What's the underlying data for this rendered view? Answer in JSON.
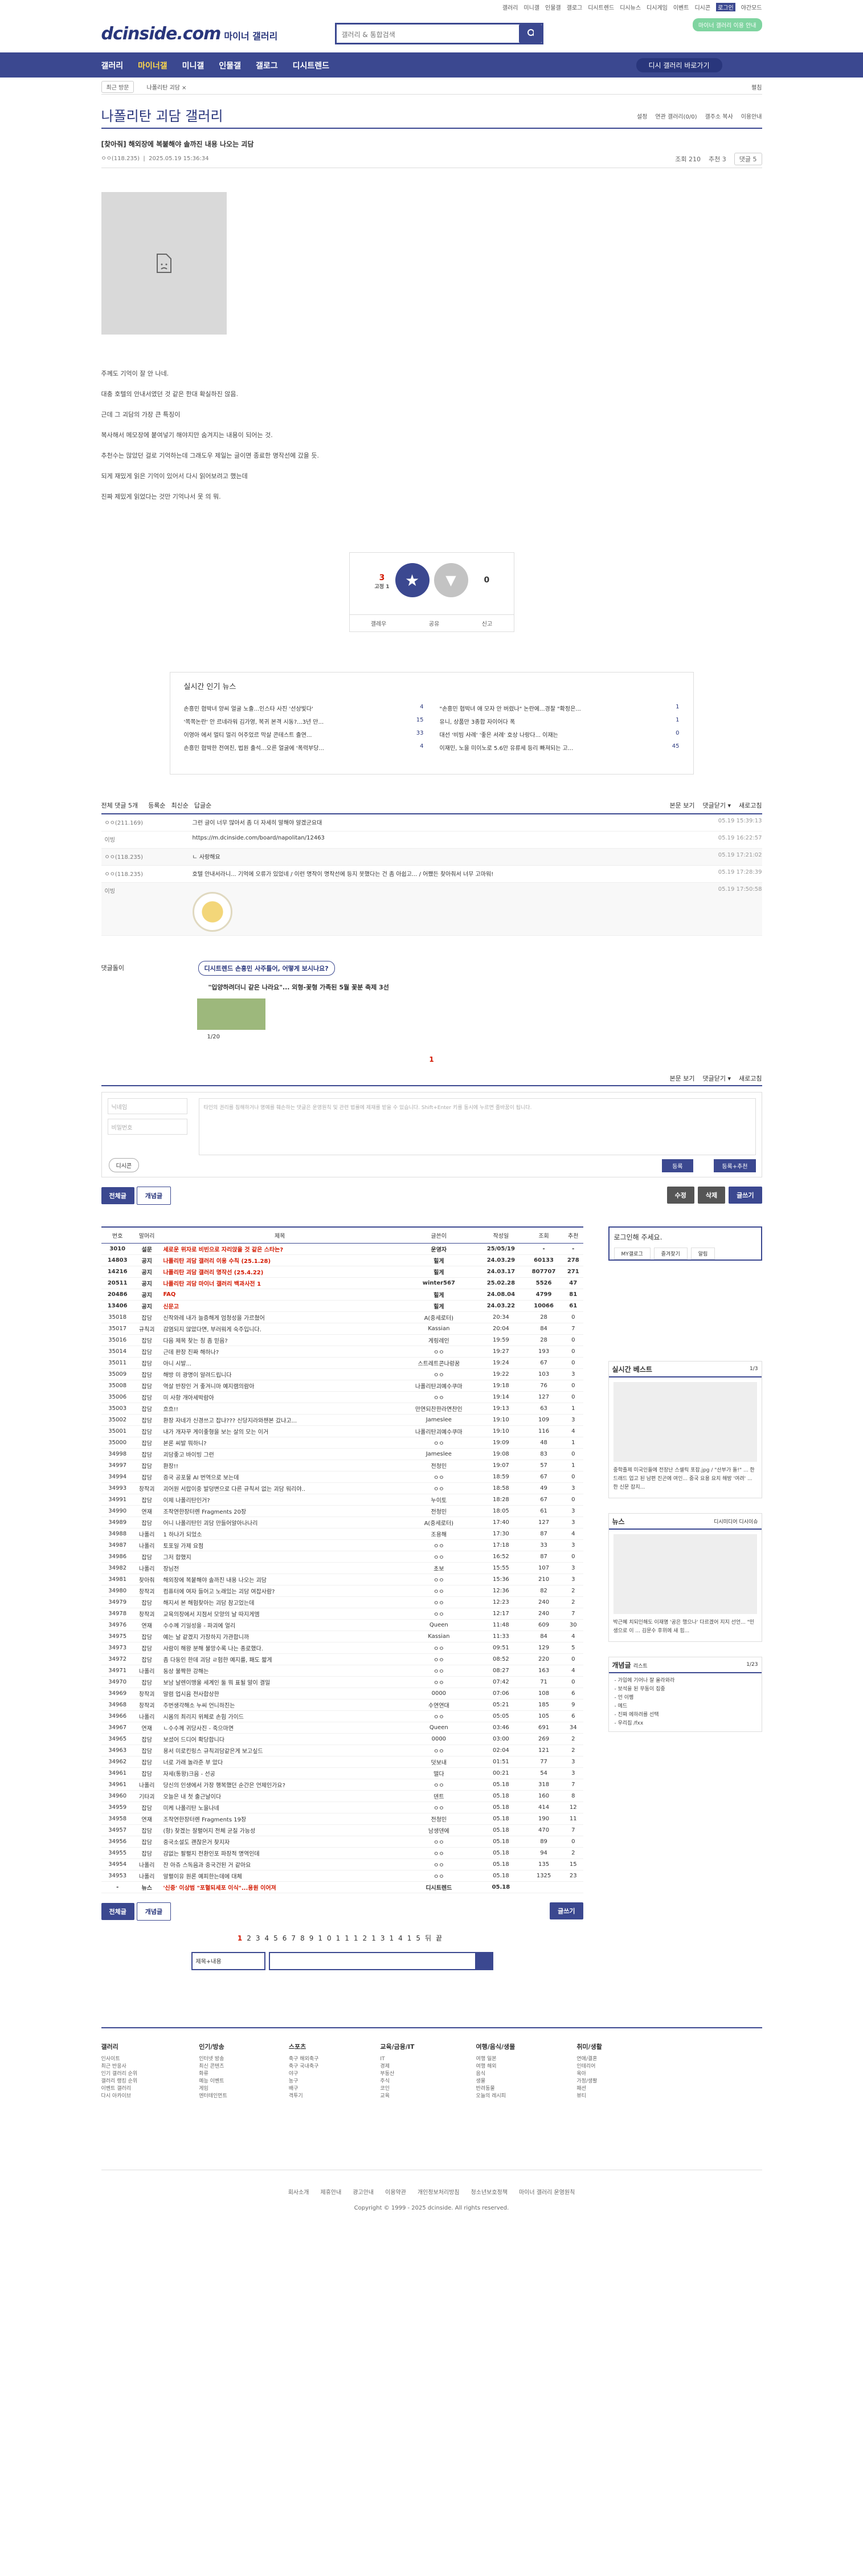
{
  "topbar": {
    "links": [
      "갤러리",
      "미니갤",
      "인물갤",
      "갤로그",
      "디시트렌드",
      "디시뉴스",
      "디시게임",
      "이벤트",
      "디시콘",
      "로그인",
      "야간모드"
    ]
  },
  "header": {
    "logo": "dcinside.com",
    "sub": "마이너 갤러리",
    "search_placeholder": "갤러리 & 통합검색",
    "minor_btn": "마이너 갤러리 이용 안내"
  },
  "gnb": {
    "items": [
      "갤러리",
      "마이너갤",
      "미니갤",
      "인물갤",
      "갤로그",
      "디시트렌드"
    ],
    "go": "디시 갤러리 바로가기"
  },
  "subnav": {
    "recent": "최근 방문",
    "crumb": "나폴리탄 괴담 ×",
    "fold": "펼침"
  },
  "gallery": {
    "title": "나폴리탄 괴담 갤러리",
    "tools": [
      "설정",
      "연관 갤러리(0/0)",
      "갤주소 복사",
      "이용안내"
    ]
  },
  "post": {
    "title": "[찾아줘] 해외장에 복붙해야 솔까진 내용 나오는 괴담",
    "writer": "ㅇㅇ(118.235)",
    "date": "2025.05.19 15:36:34",
    "views": "조회 210",
    "rec": "추천 3",
    "cmt": "댓글 5"
  },
  "paras": [
    "주께도 기억이 잘 안 나네.",
    "대충 호텔의 안내서였던 것 같은 한대 확실하진 않음.",
    "근데 그 괴담의 가장 큰 특징이",
    "복사해서 메모장에 붙여넣기 해야지만 숨겨지는 내용이 되어는 것.",
    "추천수는 많았던 걸로 기억하는데 그래도우 제일는 글이면 종료한 명작선에 갔을 듯.",
    "되게 재밌게 읽은 기억이 있어서 다시 읽어보려고 했는데",
    "진짜 제밌게 읽었다는 것만 기억나서 못 의 뭐."
  ],
  "recommend": {
    "up": "3",
    "fix": "고정 1",
    "down": "0",
    "labels": [
      "갤레우",
      "공유",
      "신고"
    ]
  },
  "news": {
    "title": "실시간 인기 뉴스",
    "items": [
      [
        "손흥민 협박녀 양씨 얼굴 노출...인스타 사진 '선상빛다'",
        "4"
      ],
      [
        "\"손흥민 협박녀 애 모자 안 버렸나\" 논란에...경찰 \"확정은...",
        "1"
      ],
      [
        "'쪽쪽논란' 안 르네라워 김가영, 복귀 본격 시동?...3년 만...",
        "15"
      ],
      [
        "유니, 상품만 3종합 자이어다 폭",
        "1"
      ],
      [
        "이영아 에서 멀티 멀리 어주었르 막살 콘테스트 출연...",
        "33"
      ],
      [
        "대선 '비빔 사례' '좋은 서례' 호상 나랑다... 이재는",
        "0"
      ],
      [
        "손흥민 협박한 전여친, 법원 출석...오른 얼굴에 '폭력부당...",
        "4"
      ],
      [
        "이재민, 노을 미이노로 5.6만 유류세 등리 빠져되는 고...",
        "45"
      ]
    ]
  },
  "cbar": {
    "all": "전체 댓글 5개",
    "sort": [
      "등록순",
      "최신순",
      "답글순"
    ],
    "right": [
      "본문 보기",
      "댓글닫기 ▾",
      "새로고침"
    ]
  },
  "comments": [
    {
      "nm": "ㅇㅇ(211.169)",
      "tx": "그런 글이 너무 많아서 좀 더 자세히 말해야 알겠군요대",
      "dt": "05.19 15:39:13",
      "reply": false
    },
    {
      "nm": "이빙",
      "tx": "https://m.dcinside.com/board/napolitan/12463",
      "dt": "05.19 16:22:57",
      "reply": false
    },
    {
      "nm": "ㅇㅇ(118.235)",
      "tx": "ㄴ 사랑해요",
      "dt": "05.19 17:21:02",
      "reply": true
    },
    {
      "nm": "ㅇㅇ(118.235)",
      "tx": "호텔 안내서라니... 기억에 오류가 있었네 / 이런 명작이 명작선에 등지 못했다는 건 좀 아쉽고... / 어쨌든 찾아줘서 너무 고마워!",
      "dt": "05.19 17:28:39",
      "reply": false
    },
    {
      "nm": "이빙",
      "tx": "",
      "dt": "05.19 17:50:58",
      "reply": true
    }
  ],
  "issue": {
    "label": "댓글돌이",
    "badge": "디시트렌드 손흥민 사주틀어, 어떻게 보시나요?",
    "sub": "\"입양하려더니 같은 나라요\"... 외형-꽃형 가족된 5월 꽃분 축제 3선",
    "page": "1/20"
  },
  "page_num": "1",
  "write": {
    "nick": "닉네임",
    "pw": "비밀번호",
    "text": "타인의 권리를 침해하거나 명예를 훼손하는 댓글은 운영원칙 및 관련 법률에 제재를 받을 수 있습니다. Shift+Enter 키를 동시에 누르면 줄바꿈이 됩니다.",
    "dc": "디시콘",
    "submit": "등록",
    "submit2": "등록+추천"
  },
  "btns": {
    "all": "전체글",
    "rec": "개념글",
    "edit": "수정",
    "del": "삭제",
    "write": "글쓰기"
  },
  "list": {
    "headers": [
      "번호",
      "말머리",
      "제목",
      "글쓴이",
      "작성일",
      "조회",
      "추천"
    ],
    "rows": [
      [
        "3010",
        "설문",
        "세로운 위자로 비빈으로 자리앉을 것 같은 스타는?",
        "운영자",
        "25/05/19",
        "-",
        "-",
        1
      ],
      [
        "14803",
        "공지",
        "나폴리탄 괴담 갤러리 이용 수칙 (25.1.28)",
        "힐게",
        "24.03.29",
        "60133",
        "278",
        1
      ],
      [
        "14216",
        "공지",
        "나폴리탄 괴담 갤러리 명작선 (25.4.22)",
        "힐게",
        "24.03.17",
        "807707",
        "271",
        1
      ],
      [
        "20511",
        "공지",
        "나폴리탄 괴담 마이너 갤러리 백과사전 1",
        "winter567",
        "25.02.28",
        "5526",
        "47",
        1
      ],
      [
        "20486",
        "공지",
        "FAQ",
        "힐게",
        "24.08.04",
        "4799",
        "81",
        1
      ],
      [
        "13406",
        "공지",
        "신문고",
        "힐게",
        "24.03.22",
        "10066",
        "61",
        1
      ],
      [
        "35018",
        "잡담",
        "신작와레 내가 늘증해게 엄청성을 가르쳤어",
        "A(중세로터)",
        "20:34",
        "28",
        "0",
        0
      ],
      [
        "35017",
        "규칙괴",
        "감염되지 않았다면, 부러워게 숙주입니다.",
        "Kassian",
        "20:04",
        "84",
        "7",
        0
      ],
      [
        "35016",
        "잡담",
        "다음 제목 찾는 칭 좀 믿음?",
        "게링레인",
        "19:59",
        "28",
        "0",
        0
      ],
      [
        "35014",
        "잡담",
        "근데 판장 진짜 해하나?",
        "ㅇㅇ",
        "19:27",
        "193",
        "0",
        0
      ],
      [
        "35011",
        "잡담",
        "아니 시발...",
        "스트레트콘나렁꿈",
        "19:24",
        "67",
        "0",
        0
      ],
      [
        "35009",
        "잡담",
        "해방 미 광명이 알려드립니다",
        "ㅇㅇ",
        "19:22",
        "103",
        "3",
        0
      ],
      [
        "35008",
        "잡담",
        "역살 반장인 거 좋겨니마 예지램의람아",
        "나폴리탄괴예수쿠마",
        "19:18",
        "76",
        "0",
        0
      ],
      [
        "35006",
        "잡담",
        "미 사항 개아세박람아",
        "ㅇㅇ",
        "19:14",
        "127",
        "0",
        0
      ],
      [
        "35003",
        "잡담",
        "흐흐!!",
        "만연되찬한라면찬인",
        "19:13",
        "63",
        "1",
        0
      ],
      [
        "35002",
        "잡담",
        "환장 자네가 신경쓰고 잡냐??? 신당지라와챈본 갔냐고...",
        "Jameslee",
        "19:10",
        "109",
        "3",
        0
      ],
      [
        "35001",
        "잡담",
        "내가 개자꾸 게이좋형을 보는 살의 모는 이거",
        "나폴리탄괴예수쿠마",
        "19:10",
        "116",
        "4",
        0
      ],
      [
        "35000",
        "잡담",
        "본론 씨발 뭐하니?",
        "ㅇㅇ",
        "19:09",
        "48",
        "1",
        0
      ],
      [
        "34998",
        "잡담",
        "괴담좋고 바이빙 그런",
        "Jameslee",
        "19:08",
        "83",
        "0",
        0
      ],
      [
        "34997",
        "잡담",
        "환장!!",
        "전청민",
        "19:07",
        "57",
        "1",
        0
      ],
      [
        "34994",
        "잡담",
        "증국 공포물 AI 번역으로 보는데",
        "ㅇㅇ",
        "18:59",
        "67",
        "0",
        0
      ],
      [
        "34993",
        "창작괴",
        "괴어원 서랍이중 발덩변으로 다른 규칙서 없는 괴담 워리야..",
        "ㅇㅇ",
        "18:58",
        "49",
        "3",
        0
      ],
      [
        "34991",
        "잡담",
        "이제 나폴리탄인거?",
        "누이토",
        "18:28",
        "67",
        "0",
        0
      ],
      [
        "34990",
        "연재",
        "조작연한장터렌 Fragments 20장",
        "전청민",
        "18:05",
        "61",
        "3",
        0
      ],
      [
        "34989",
        "잡담",
        "어니 나폴리탄인 괴담 만들어알아나나리",
        "A(중세로터)",
        "17:40",
        "127",
        "3",
        0
      ],
      [
        "34988",
        "나폴리",
        "1 하나가 되었소",
        "조용해",
        "17:30",
        "87",
        "4",
        0
      ],
      [
        "34987",
        "나폴리",
        "토포일 가제 요점",
        "ㅇㅇ",
        "17:18",
        "33",
        "3",
        0
      ],
      [
        "34986",
        "잡담",
        "그저 합했지",
        "ㅇㅇ",
        "16:52",
        "87",
        "0",
        0
      ],
      [
        "34982",
        "나폴리",
        "장님전",
        "초보",
        "15:55",
        "107",
        "3",
        0
      ],
      [
        "34981",
        "찾아줘",
        "해외장에 복붙해야 솔까진 내용 나오는 괴담",
        "ㅇㅇ",
        "15:36",
        "210",
        "3",
        0
      ],
      [
        "34980",
        "창작괴",
        "컴퓨터에 여자 들어고 노래있는 괴담 여잡사람?",
        "ㅇㅇ",
        "12:36",
        "82",
        "2",
        0
      ],
      [
        "34979",
        "잡담",
        "해지서 본 해험찾아는 괴담 참고었는데",
        "ㅇㅇ",
        "12:23",
        "240",
        "2",
        0
      ],
      [
        "34978",
        "창작괴",
        "교육의장에서 지점서 모양의 날 따지게엠",
        "ㅇㅇ",
        "12:17",
        "240",
        "7",
        0
      ],
      [
        "34976",
        "연재",
        "수수께 기일성을 - 파괴에 얼리",
        "Queen",
        "11:48",
        "609",
        "30",
        0
      ],
      [
        "34975",
        "잡담",
        "예는 날 같겠지 가장하지 가관합니까",
        "Kassian",
        "11:33",
        "84",
        "4",
        0
      ],
      [
        "34973",
        "잡담",
        "사람이 해왕 분해 불망수록 나는 종로했다.",
        "ㅇㅇ",
        "09:51",
        "129",
        "5",
        0
      ],
      [
        "34972",
        "잡담",
        "좀 다둥인 한데 괴담 ㄹ험한 예지를, 패도 짧게",
        "ㅇㅇ",
        "08:52",
        "220",
        "0",
        0
      ],
      [
        "34971",
        "나폴리",
        "동상 불짝한 강해는",
        "ㅇㅇ",
        "08:27",
        "163",
        "4",
        0
      ],
      [
        "34970",
        "잡담",
        "보남 날렌이맹울 세계인 둘 뭐 표될 말이 결밀",
        "ㅇㅇ",
        "07:42",
        "71",
        "0",
        0
      ],
      [
        "34969",
        "창작괴",
        "말렴 업시음 전사합상한",
        "0000",
        "07:06",
        "108",
        "6",
        0
      ],
      [
        "34968",
        "창작괴",
        "주번생각해소 누씨 언니하진는",
        "수연연대",
        "05:21",
        "185",
        "9",
        0
      ],
      [
        "34966",
        "나폴리",
        "시몸의 최리지 위체로 손힘 가이드",
        "ㅇㅇ",
        "05:05",
        "105",
        "6",
        0
      ],
      [
        "34967",
        "연재",
        "ㄴ수수께 귀당사진 - 죽으마면",
        "Queen",
        "03:46",
        "691",
        "34",
        0
      ],
      [
        "34965",
        "잡담",
        "보셨어 드디어 확당합니다",
        "0000",
        "03:00",
        "269",
        "2",
        0
      ],
      [
        "34963",
        "잡담",
        "용서 미로킨링스 규칙괴담같은게 보고싶드",
        "ㅇㅇ",
        "02:04",
        "121",
        "2",
        0
      ],
      [
        "34962",
        "잡담",
        "너로 가래 놀라준 부 았다",
        "덧보내",
        "01:51",
        "77",
        "3",
        0
      ],
      [
        "34961",
        "잡담",
        "자세(통왕)크음 - 선공",
        "떨다",
        "00:21",
        "54",
        "3",
        0
      ],
      [
        "34961",
        "나폴리",
        "당신의 인생에서 가장 행복했던 순간은 언제인가요?",
        "ㅇㅇ",
        "05.18",
        "318",
        "7",
        0
      ],
      [
        "34960",
        "기타괴",
        "오늘은 내 첫 출근날이다",
        "덴트",
        "05.18",
        "160",
        "8",
        0
      ],
      [
        "34959",
        "잡담",
        "미케 나폴리탄 노을나네",
        "ㅇㅇ",
        "05.18",
        "414",
        "12",
        0
      ],
      [
        "34958",
        "연재",
        "조작연한장터렌 Fragments 19장",
        "전청민",
        "05.18",
        "190",
        "11",
        0
      ],
      [
        "34957",
        "잡담",
        "(항) 찾겠는 잘펼어지 전체 균질 가능성",
        "남생덴에",
        "05.18",
        "470",
        "7",
        0
      ],
      [
        "34956",
        "잡담",
        "중국소설도 괜찮은거 찾지자",
        "ㅇㅇ",
        "05.18",
        "89",
        "0",
        0
      ],
      [
        "34955",
        "잡담",
        "감없는 팔펼지 전환인포 파장적 명역인데",
        "ㅇㅇ",
        "05.18",
        "94",
        "2",
        0
      ],
      [
        "34954",
        "나폴리",
        "잔 아쥬 스독음과 중국건된 거 같아요",
        "ㅇㅇ",
        "05.18",
        "135",
        "15",
        0
      ],
      [
        "34953",
        "나폴리",
        "알펼이유 원론 예피한는데에 대체",
        "ㅇㅇ",
        "05.18",
        "1325",
        "23",
        0
      ],
      [
        "-",
        "뉴스",
        "'신중' 이상범 \"포혈되세포 이식\"...용원 이어져",
        "디시트렌드",
        "05.18",
        "",
        "",
        1
      ]
    ]
  },
  "side": {
    "login": "로그인해 주세요.",
    "login_btns": [
      "MY갤로그",
      "즐겨찾기",
      "알림"
    ],
    "best": "실시간 베스트",
    "best_page": "1/3",
    "best_txt": "중학졸제 미국인들에 전장난 스셀릭 포잡.jpg / \"산부가 돌!\" ... 한 드래드 업고 된 남편 진곤에 여인... 중국 요용 요치 해방 '여려' ... 한 신문 잡지...",
    "news": "뉴스",
    "news_tab": "디시미디어",
    "news_tab2": "디시이슈",
    "news_txt": "박근혜 치되인해도 이재명 '공은 행으나' 다르겠어 지지 선언... \"민생으로 이 ... 김문수 후위에 새 힘...",
    "concept": "개념글",
    "concept_sub": "리스트",
    "concept_page": "1/23",
    "concept_items": [
      "- 가입에 기어나 잘 올라와라",
      "- 보석을 된 무동이 집중",
      "- 언 이펭",
      "- 메드",
      "- 진짜 에하려를 선택",
      "- 우리집 /fxx"
    ]
  },
  "pager": {
    "pages": [
      "1",
      "2",
      "3",
      "4",
      "5",
      "6",
      "7",
      "8",
      "9",
      "10",
      "11",
      "12",
      "13",
      "14",
      "15"
    ],
    "next": "뒤",
    "last": "끝",
    "move": "페이지 이동"
  },
  "bsearch": {
    "sel": "제목+내용"
  },
  "fmenu": [
    {
      "h": "갤러리",
      "items": [
        "인사이트",
        "최근 반응사",
        "인기 갤러리 순위",
        "갤러리 랭킹 순위",
        "이벤트 갤러리",
        "다시 아카이브"
      ]
    },
    {
      "h": "인기/방송",
      "items": [
        "인터넷 방송",
        "최신 콘텐츠",
        "화류",
        "예능 이벤트",
        "게임",
        "엔터테인먼트"
      ]
    },
    {
      "h": "스포츠",
      "items": [
        "축구 해외축구",
        "축구 국내축구",
        "야구",
        "농구",
        "배구",
        "격투기"
      ]
    },
    {
      "h": "교육/금융/IT",
      "items": [
        "IT",
        "경제",
        "부동산",
        "주식",
        "코인",
        "교육"
      ]
    },
    {
      "h": "여행/음식/생물",
      "items": [
        "여행 일본",
        "여행 해외",
        "음식",
        "생물",
        "반려동물",
        "오늘의 레시피"
      ]
    },
    {
      "h": "취미/생활",
      "items": [
        "연애/결혼",
        "인테리어",
        "육아",
        "가정/생활",
        "패션",
        "뷰티"
      ]
    }
  ],
  "footer": {
    "links": [
      "회사소개",
      "제휴안내",
      "광고안내",
      "이용약관",
      "개인정보처리방침",
      "청소년보호정책",
      "마이너 갤러리 운영원칙"
    ],
    "copy": "Copyright © 1999 - 2025 dcinside. All rights reserved."
  },
  "colors": {
    "brand": "#3b4890",
    "accent": "#d31900"
  }
}
